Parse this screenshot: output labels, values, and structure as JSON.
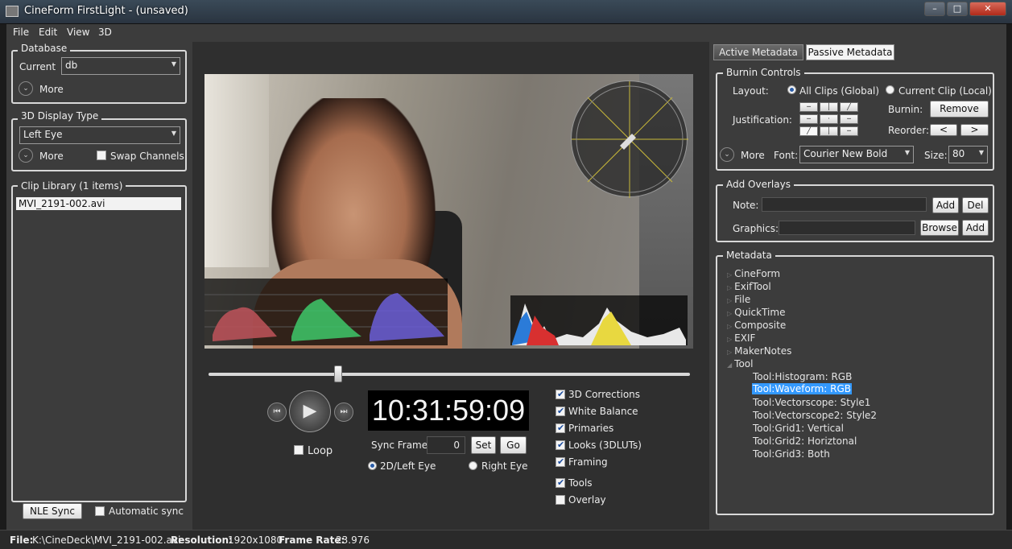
{
  "window": {
    "title": "CineForm FirstLight - (unsaved)"
  },
  "menu": [
    "File",
    "Edit",
    "View",
    "3D"
  ],
  "database": {
    "title": "Database",
    "current_label": "Current",
    "current_value": "db",
    "more_label": "More"
  },
  "display": {
    "title": "3D Display Type",
    "value": "Left Eye",
    "more_label": "More",
    "swap_label": "Swap Channels"
  },
  "clip_library": {
    "title": "Clip Library (1 items)",
    "items": [
      "MVI_2191-002.avi"
    ]
  },
  "left_footer": {
    "nle_sync": "NLE Sync",
    "auto_sync": "Automatic sync"
  },
  "transport": {
    "timecode": "10:31:59:09",
    "loop_label": "Loop",
    "sync_frame_label": "Sync Frame:",
    "sync_frame_value": "0",
    "set_label": "Set",
    "go_label": "Go",
    "eye_left": "2D/Left Eye",
    "eye_right": "Right Eye",
    "scrub_position": 0.27
  },
  "options": [
    {
      "label": "3D Corrections",
      "checked": true
    },
    {
      "label": "White  Balance",
      "checked": true
    },
    {
      "label": "Primaries",
      "checked": true
    },
    {
      "label": "Looks (3DLUTs)",
      "checked": true
    },
    {
      "label": "Framing",
      "checked": true
    },
    {
      "label": "Tools",
      "checked": true
    },
    {
      "label": "Overlay",
      "checked": false
    }
  ],
  "tabs": {
    "active": "Active Metadata",
    "passive": "Passive Metadata"
  },
  "burnin": {
    "title": "Burnin Controls",
    "layout_label": "Layout:",
    "all_clips": "All Clips (Global)",
    "current_clip": "Current Clip (Local)",
    "justification_label": "Justification:",
    "burnin_label": "Burnin:",
    "remove_label": "Remove",
    "reorder_label": "Reorder:",
    "reorder_prev": "<",
    "reorder_next": ">",
    "more_label": "More",
    "font_label": "Font:",
    "font_value": "Courier New Bold",
    "size_label": "Size:",
    "size_value": "80"
  },
  "overlays": {
    "title": "Add Overlays",
    "note_label": "Note:",
    "graphics_label": "Graphics:",
    "add_label": "Add",
    "del_label": "Del",
    "browse_label": "Browse",
    "add2_label": "Add"
  },
  "metadata": {
    "title": "Metadata",
    "nodes": [
      "CineForm",
      "ExifTool",
      "File",
      "QuickTime",
      "Composite",
      "EXIF",
      "MakerNotes"
    ],
    "tool_node": "Tool",
    "tool_children": [
      "Tool:Histogram: RGB",
      "Tool:Waveform: RGB",
      "Tool:Vectorscope: Style1",
      "Tool:Vectorscope2: Style2",
      "Tool:Grid1: Vertical",
      "Tool:Grid2: Horiztonal",
      "Tool:Grid3: Both"
    ],
    "selected_index": 1
  },
  "status": {
    "file_label": "File:",
    "file_value": "K:\\CineDeck\\MVI_2191-002.avi",
    "res_label": "Resolution:",
    "res_value": "1920x1080",
    "rate_label": "Frame Rate:",
    "rate_value": "23.976"
  },
  "colors": {
    "selection": "#3399ff",
    "timecode_bg": "#000000"
  }
}
